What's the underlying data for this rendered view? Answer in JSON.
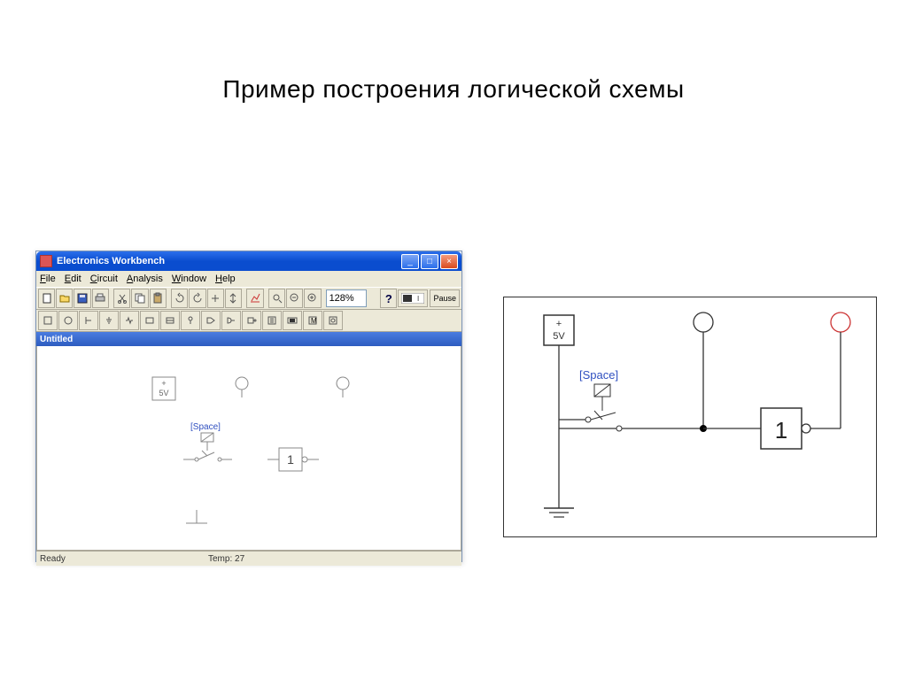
{
  "slide": {
    "title": "Пример построения логической схемы"
  },
  "app": {
    "title": "Electronics Workbench",
    "menu": [
      "File",
      "Edit",
      "Circuit",
      "Analysis",
      "Window",
      "Help"
    ],
    "zoom": "128%",
    "help": "?",
    "pause": "Pause",
    "doc_title": "Untitled",
    "status_left": "Ready",
    "status_temp": "Temp: 27",
    "toolbar_icons": [
      "new",
      "open",
      "save",
      "print",
      "cut",
      "copy",
      "paste",
      "undo",
      "redo",
      "rotate-left",
      "rotate-right",
      "flip-h",
      "flip-v",
      "graph",
      "search",
      "zoom-out",
      "zoom-in"
    ],
    "toolbar2_icons": [
      "src1",
      "src2",
      "src3",
      "src4",
      "src5",
      "meter1",
      "meter2",
      "probe",
      "gate1",
      "gate2",
      "gate3",
      "gate4",
      "gate5",
      "gate6",
      "display",
      "m-box",
      "misc"
    ]
  },
  "canvas": {
    "source": {
      "line1": "+",
      "line2": "5V"
    },
    "switch_label": "[Space]",
    "gate_label": "1"
  },
  "schematic": {
    "source": {
      "line1": "+",
      "line2": "5V"
    },
    "switch_label": "[Space]",
    "gate_label": "1"
  }
}
